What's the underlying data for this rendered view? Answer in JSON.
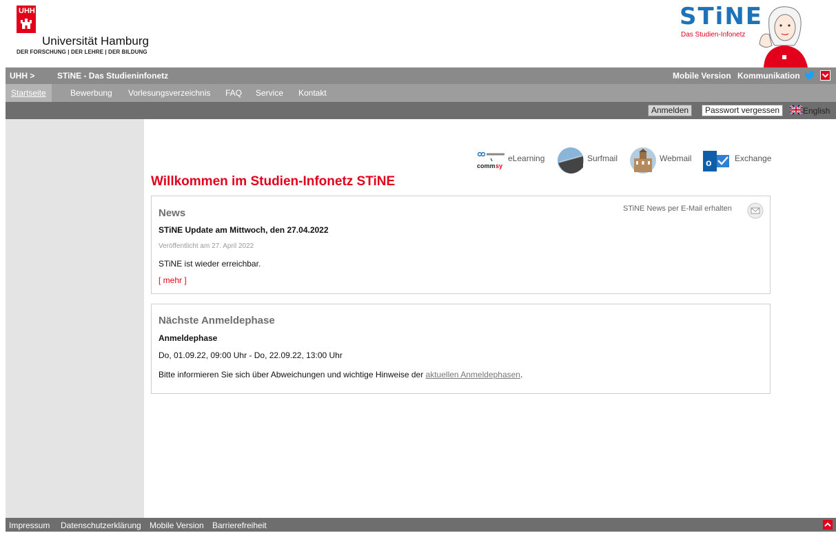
{
  "colors": {
    "accent": "#e2001a",
    "stine_blue": "#1d72b8",
    "topbar": "#8a8a8a",
    "mainnav": "#9d9d9d",
    "loginbar": "#6e6e6e",
    "sidebar": "#e4e4e4"
  },
  "header": {
    "uhh_badge": "UHH",
    "university_name": "Universität Hamburg",
    "university_tagline": "DER FORSCHUNG | DER LEHRE | DER BILDUNG",
    "stine_logo": "STiNE",
    "stine_subtitle": "Das Studien-Infonetz"
  },
  "topbar": {
    "breadcrumb_home": "UHH >",
    "breadcrumb_current": "STiNE - Das Studieninfonetz",
    "mobile_link": "Mobile Version",
    "kommunikation_link": "Kommunikation",
    "icons": [
      "twitter-icon",
      "chevron-down-icon"
    ]
  },
  "mainnav": {
    "items": [
      {
        "label": "Startseite",
        "active": true
      },
      {
        "label": "Bewerbung"
      },
      {
        "label": "Vorlesungsverzeichnis"
      },
      {
        "label": "FAQ"
      },
      {
        "label": "Service"
      },
      {
        "label": "Kontakt"
      }
    ]
  },
  "loginbar": {
    "login_label": "Anmelden",
    "forgot_password_label": "Passwort vergessen",
    "language_label": "English",
    "flag_icon": "uk-flag-icon"
  },
  "services": [
    {
      "label": "eLearning",
      "icon": "openolat-commsy-icon"
    },
    {
      "label": "Surfmail",
      "icon": "surfmail-icon"
    },
    {
      "label": "Webmail",
      "icon": "webmail-icon"
    },
    {
      "label": "Exchange",
      "icon": "outlook-icon"
    }
  ],
  "main": {
    "title": "Willkommen im Studien-Infonetz STiNE",
    "news": {
      "title": "News",
      "subscribe_label": "STiNE News per E-Mail erhalten",
      "headline": "STiNE Update am Mittwoch, den 27.04.2022",
      "published": "Veröffentlicht am 27. April 2022",
      "body": "STiNE ist wieder erreichbar.",
      "more_label": "[ mehr ]"
    },
    "registration": {
      "title": "Nächste Anmeldephase",
      "subtitle": "Anmeldephase",
      "dates": "Do, 01.09.22, 09:00 Uhr - Do, 22.09.22, 13:00 Uhr",
      "hint_prefix": "Bitte informieren Sie sich über Abweichungen und wichtige Hinweise der ",
      "hint_link": "aktuellen Anmeldephasen",
      "hint_suffix": "."
    }
  },
  "footer": {
    "links": [
      "Impressum",
      "Datenschutzerklärung",
      "Mobile Version",
      "Barrierefreiheit"
    ],
    "top_icon": "chevron-up-icon"
  }
}
